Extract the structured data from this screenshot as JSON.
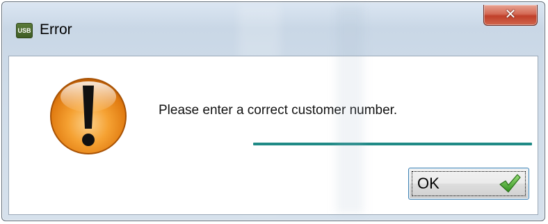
{
  "window": {
    "title": "Error",
    "app_icon_text": "USB",
    "close_glyph": "✕"
  },
  "dialog": {
    "icon": "warning-exclamation-icon",
    "message": "Please enter a correct customer number.",
    "progress_fraction": 1.0,
    "ok_label": "OK",
    "ok_icon": "checkmark-icon"
  },
  "colors": {
    "progress": "#1f8a86",
    "warning_orange": "#f08c1e",
    "close_red": "#c0402a",
    "check_green": "#3aa02a"
  }
}
